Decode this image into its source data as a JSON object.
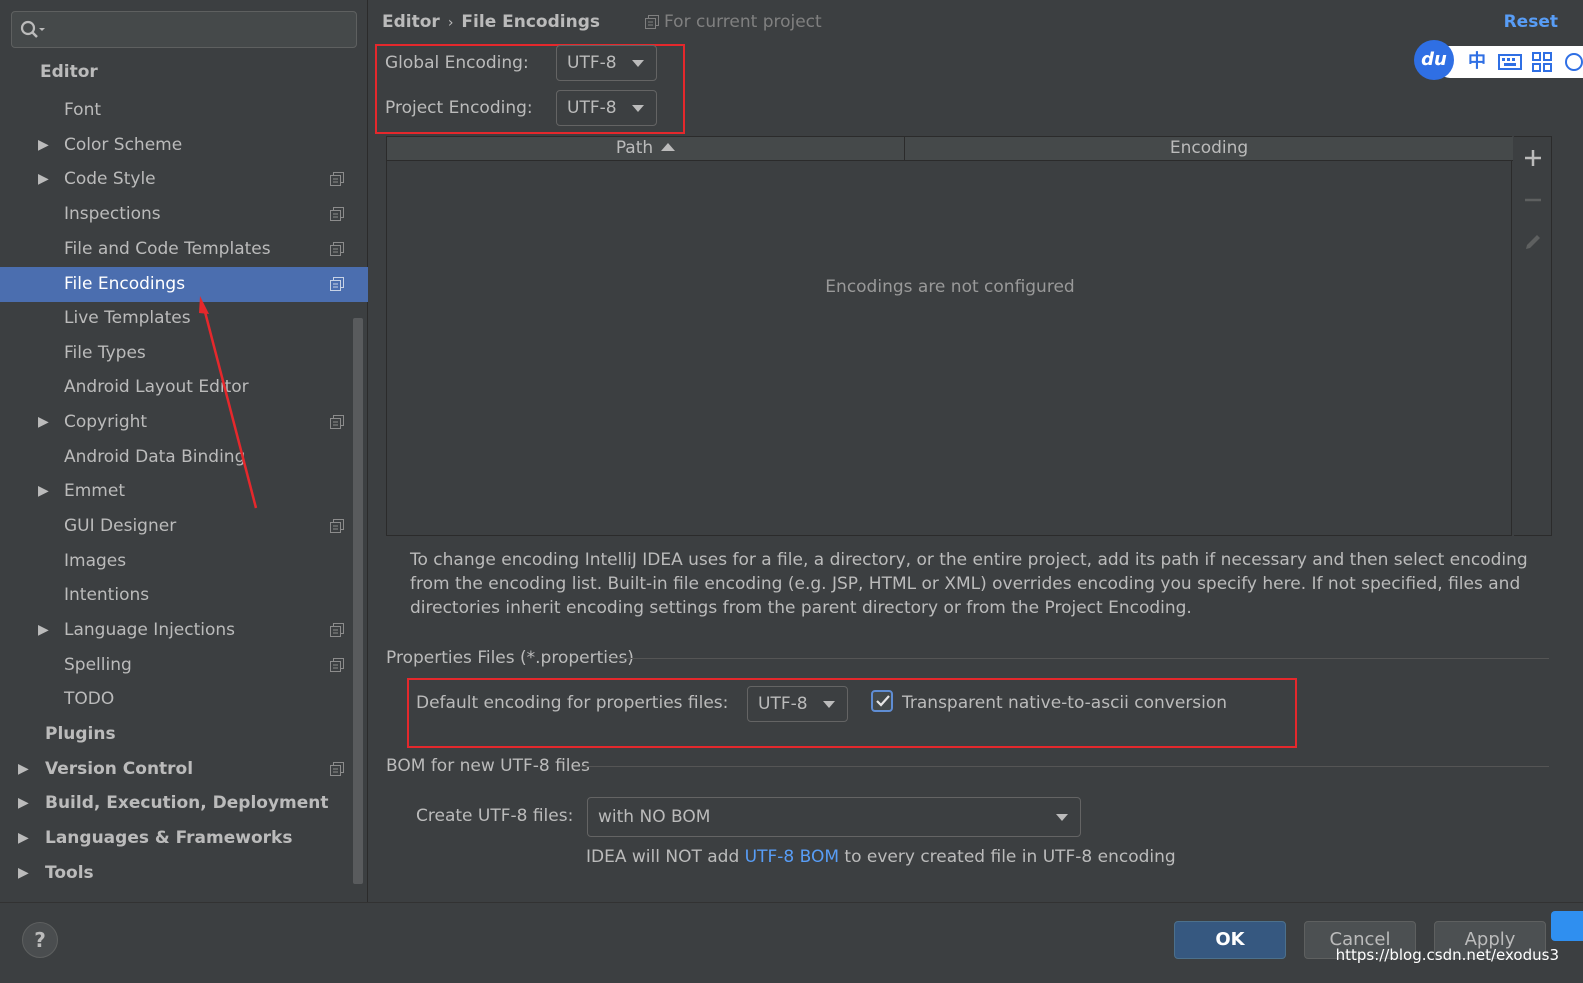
{
  "search": {
    "placeholder": ""
  },
  "sidebar": {
    "items": [
      {
        "label": "Editor"
      },
      {
        "label": "Font"
      },
      {
        "label": "Color Scheme"
      },
      {
        "label": "Code Style"
      },
      {
        "label": "Inspections"
      },
      {
        "label": "File and Code Templates"
      },
      {
        "label": "File Encodings"
      },
      {
        "label": "Live Templates"
      },
      {
        "label": "File Types"
      },
      {
        "label": "Android Layout Editor"
      },
      {
        "label": "Copyright"
      },
      {
        "label": "Android Data Binding"
      },
      {
        "label": "Emmet"
      },
      {
        "label": "GUI Designer"
      },
      {
        "label": "Images"
      },
      {
        "label": "Intentions"
      },
      {
        "label": "Language Injections"
      },
      {
        "label": "Spelling"
      },
      {
        "label": "TODO"
      },
      {
        "label": "Plugins"
      },
      {
        "label": "Version Control"
      },
      {
        "label": "Build, Execution, Deployment"
      },
      {
        "label": "Languages & Frameworks"
      },
      {
        "label": "Tools"
      }
    ]
  },
  "header": {
    "crumb_parent": "Editor",
    "crumb_current": "File Encodings",
    "scope": "For current project",
    "reset": "Reset"
  },
  "encodings": {
    "global_label": "Global Encoding:",
    "global_value": "UTF-8",
    "project_label": "Project Encoding:",
    "project_value": "UTF-8"
  },
  "table": {
    "columns": [
      "Path",
      "Encoding"
    ],
    "empty_text": "Encodings are not configured"
  },
  "help_text": "To change encoding IntelliJ IDEA uses for a file, a directory, or the entire project, add its path if necessary and then select encoding from the encoding list. Built-in file encoding (e.g. JSP, HTML or XML) overrides encoding you specify here. If not specified, files and directories inherit encoding settings from the parent directory or from the Project Encoding.",
  "properties": {
    "group_title": "Properties Files (*.properties)",
    "default_label": "Default encoding for properties files:",
    "default_value": "UTF-8",
    "transparent_label": "Transparent native-to-ascii conversion",
    "transparent_checked": true
  },
  "bom": {
    "group_title": "BOM for new UTF-8 files",
    "create_label": "Create UTF-8 files:",
    "create_value": "with NO BOM",
    "note_prefix": "IDEA will NOT add ",
    "note_link": "UTF-8 BOM",
    "note_suffix": " to every created file in UTF-8 encoding"
  },
  "ime": {
    "logo": "du",
    "lang": "中"
  },
  "footer": {
    "help": "?",
    "ok": "OK",
    "cancel": "Cancel",
    "apply": "Apply",
    "watermark": "https://blog.csdn.net/exodus3"
  },
  "colors": {
    "accent": "#4b6eaf",
    "link": "#589df6",
    "annotation": "#e5282c",
    "background": "#3c3f41"
  }
}
